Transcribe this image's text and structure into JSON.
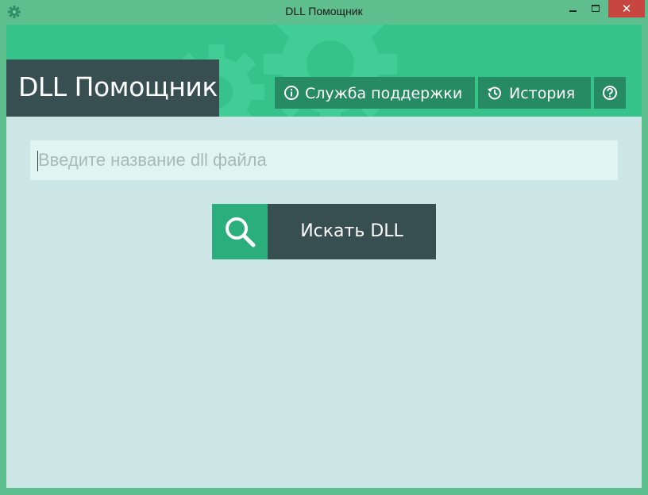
{
  "window": {
    "title": "DLL Помощник"
  },
  "header": {
    "brand": "DLL Помощник",
    "support_label": "Служба поддержки",
    "history_label": "История"
  },
  "search": {
    "placeholder": "Введите название dll файла",
    "button_label": "Искать DLL"
  },
  "colors": {
    "frame": "#5fbe8e",
    "header_green": "#36c38a",
    "dark_slate": "#384f51",
    "nav_button": "#268a62",
    "search_icon_bg": "#2aae7c",
    "content_bg": "#cde6e6",
    "input_bg": "#e0f4f2",
    "close_red": "#c7453f"
  },
  "icons": {
    "app": "gear-icon",
    "support": "info-icon",
    "history": "history-icon",
    "help": "question-icon",
    "search": "magnifier-icon"
  }
}
